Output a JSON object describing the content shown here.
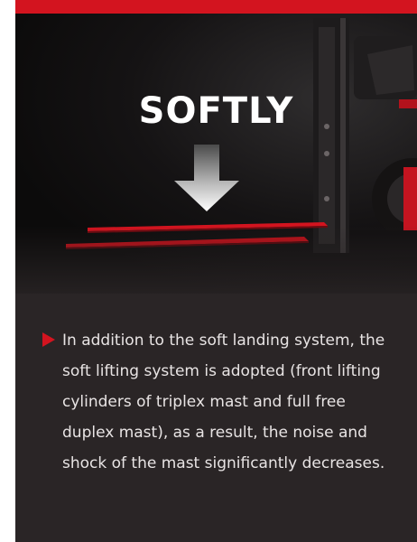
{
  "banner": {
    "headline": "SOFTLY",
    "arrow_icon": "down-arrow-icon",
    "image_subject": "forklift-forks-icon"
  },
  "description": {
    "bullet_icon": "red-triangle-bullet-icon",
    "text": "In addition to the soft landing system, the soft lifting system is adopted (front lifting cylinders of triplex mast and full free duplex mast), as a result, the noise and shock of the mast significantly decreases."
  },
  "colors": {
    "accent": "#d3141f",
    "panel": "#2a2526",
    "text": "#e8e4e4"
  }
}
